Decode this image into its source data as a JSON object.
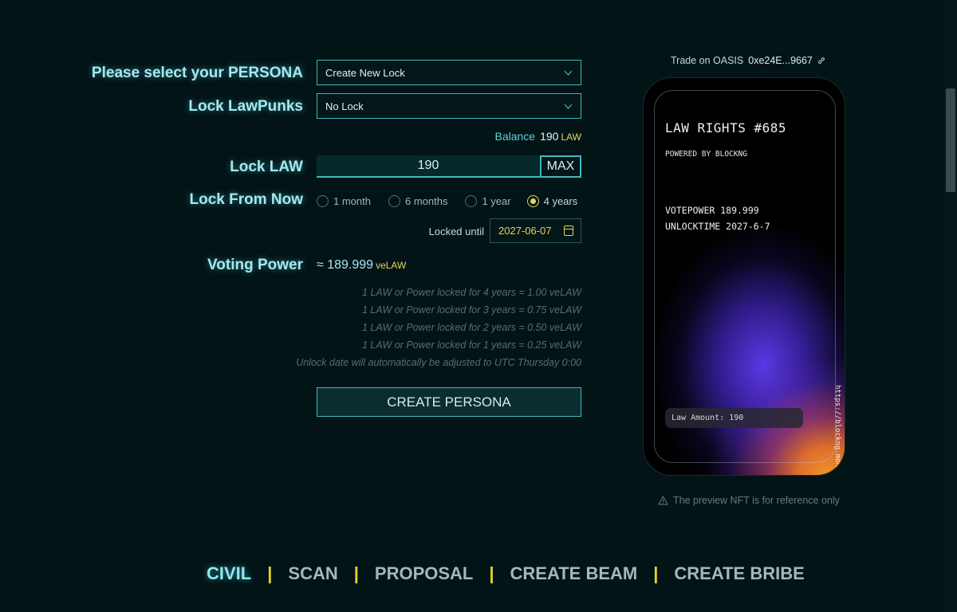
{
  "form": {
    "persona_label": "Please select your PERSONA",
    "persona_value": "Create New Lock",
    "lawpunks_label": "Lock LawPunks",
    "lawpunks_value": "No Lock",
    "balance_label": "Balance",
    "balance_value": "190",
    "balance_unit": "LAW",
    "lock_law_label": "Lock LAW",
    "lock_law_value": "190",
    "max_label": "MAX",
    "lock_from_now_label": "Lock From Now",
    "durations": [
      {
        "label": "1 month",
        "checked": false
      },
      {
        "label": "6 months",
        "checked": false
      },
      {
        "label": "1 year",
        "checked": false
      },
      {
        "label": "4 years",
        "checked": true
      }
    ],
    "locked_until_label": "Locked until",
    "locked_until_value": "2027-06-07",
    "voting_power_label": "Voting Power",
    "voting_power_value": "≈ 189.999",
    "voting_power_unit": "veLAW",
    "info_lines": [
      "1 LAW or Power locked for 4 years = 1.00 veLAW",
      "1 LAW or Power locked for 3 years = 0.75 veLAW",
      "1 LAW or Power locked for 2 years = 0.50 veLAW",
      "1 LAW or Power locked for 1 years = 0.25 veLAW",
      "Unlock date will automatically be adjusted to UTC Thursday 0:00"
    ],
    "create_button": "CREATE PERSONA"
  },
  "preview": {
    "trade_label": "Trade on OASIS",
    "trade_address": "0xe24E...9667",
    "nft_title": "LAW RIGHTS #685",
    "nft_subtitle": "POWERED BY BLOCKNG",
    "nft_votepower": "VOTEPOWER 189.999",
    "nft_unlocktime": "UNLOCKTIME 2027-6-7",
    "nft_amount": "Law Amount: 190",
    "nft_url": "https://blockng.money/",
    "note": "The preview NFT is for reference only"
  },
  "footer_nav": [
    "CIVIL",
    "SCAN",
    "PROPOSAL",
    "CREATE BEAM",
    "CREATE BRIBE"
  ],
  "colors": {
    "background": "#031417",
    "accent_cyan": "#3fb9bd",
    "accent_yellow": "#e0d75a"
  }
}
